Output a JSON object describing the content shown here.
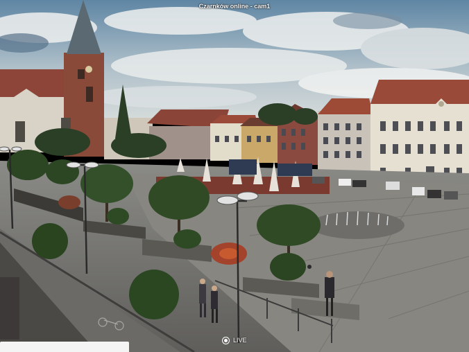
{
  "camera": {
    "title": "Czarnków online - cam1"
  },
  "player": {
    "live_label": "LIVE"
  },
  "colors": {
    "sky_top": "#6d8fa8",
    "sky_bottom": "#c9d2d6",
    "roof_red": "#8e4a3c",
    "pavement": "#7d7c76",
    "foliage": "#2f4a24"
  }
}
